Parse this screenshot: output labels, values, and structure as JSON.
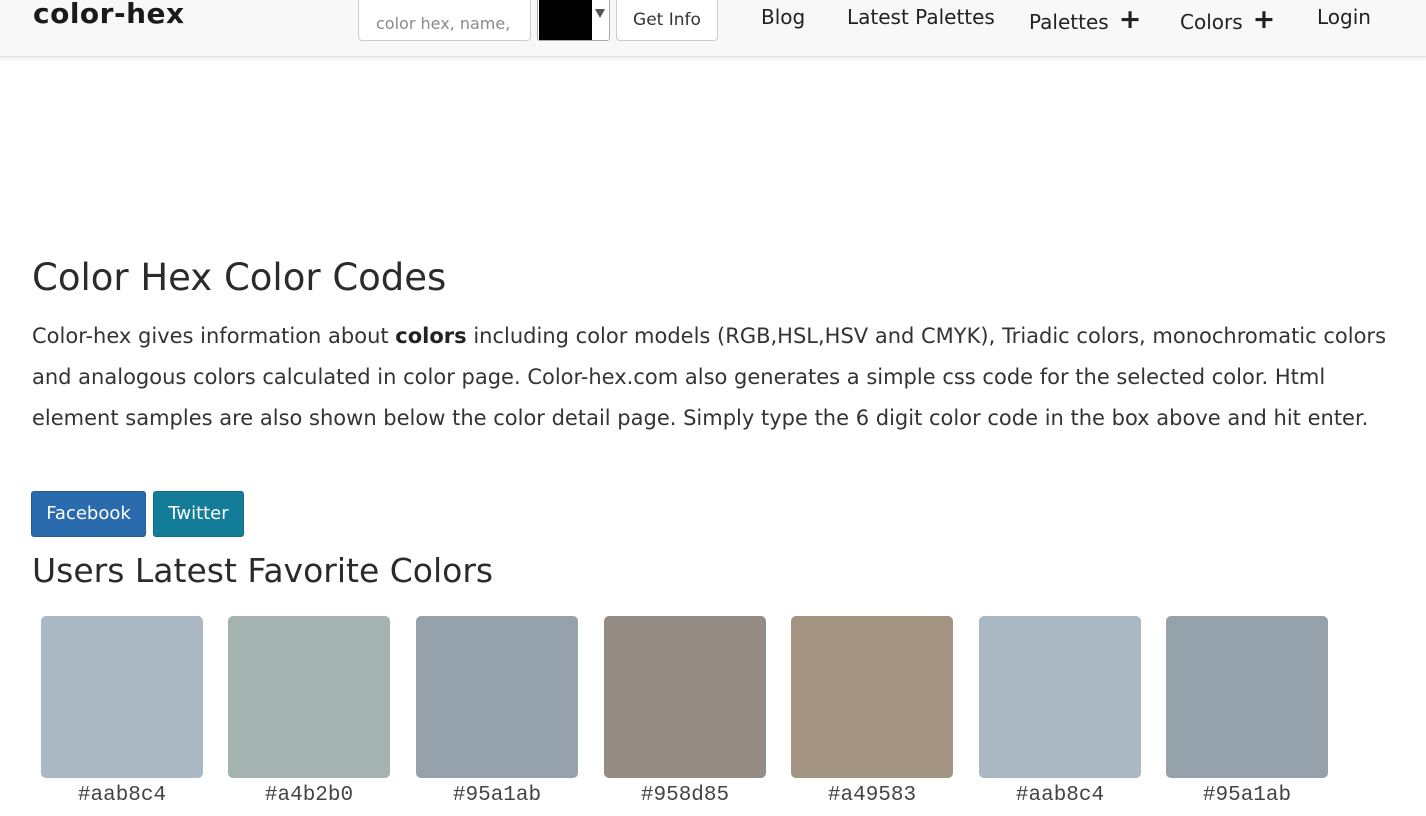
{
  "header": {
    "brand": "color-hex",
    "search_placeholder": "color hex, name,",
    "picker_color": "#000000",
    "get_info_label": "Get Info",
    "nav": {
      "blog": "Blog",
      "latest_palettes": "Latest Palettes",
      "palettes": "Palettes",
      "colors": "Colors",
      "login": "Login",
      "expand_symbol": "+"
    }
  },
  "main": {
    "title": "Color Hex Color Codes",
    "intro_before": "Color-hex gives information about ",
    "intro_bold": "colors",
    "intro_after": " including color models (RGB,HSL,HSV and CMYK), Triadic colors, monochromatic colors and analogous colors calculated in color page. Color-hex.com also generates a simple css code for the selected color. Html element samples are also shown below the color detail page. Simply type the 6 digit color code in the box above and hit enter.",
    "facebook_label": "Facebook",
    "twitter_label": "Twitter",
    "favorites_title": "Users Latest Favorite Colors",
    "favorites": [
      {
        "hex": "#aab8c4",
        "color": "#aab8c4"
      },
      {
        "hex": "#a4b2b0",
        "color": "#a4b2b0"
      },
      {
        "hex": "#95a1ab",
        "color": "#95a1ab"
      },
      {
        "hex": "#958d85",
        "color": "#958d85"
      },
      {
        "hex": "#a49583",
        "color": "#a49583"
      },
      {
        "hex": "#aab8c4",
        "color": "#aab8c4"
      },
      {
        "hex": "#95a1ab",
        "color": "#95a1ab"
      }
    ]
  },
  "colors": {
    "facebook_button": "#2a6bad",
    "twitter_button": "#137d99",
    "navbar_bg": "#f8f8f8"
  }
}
